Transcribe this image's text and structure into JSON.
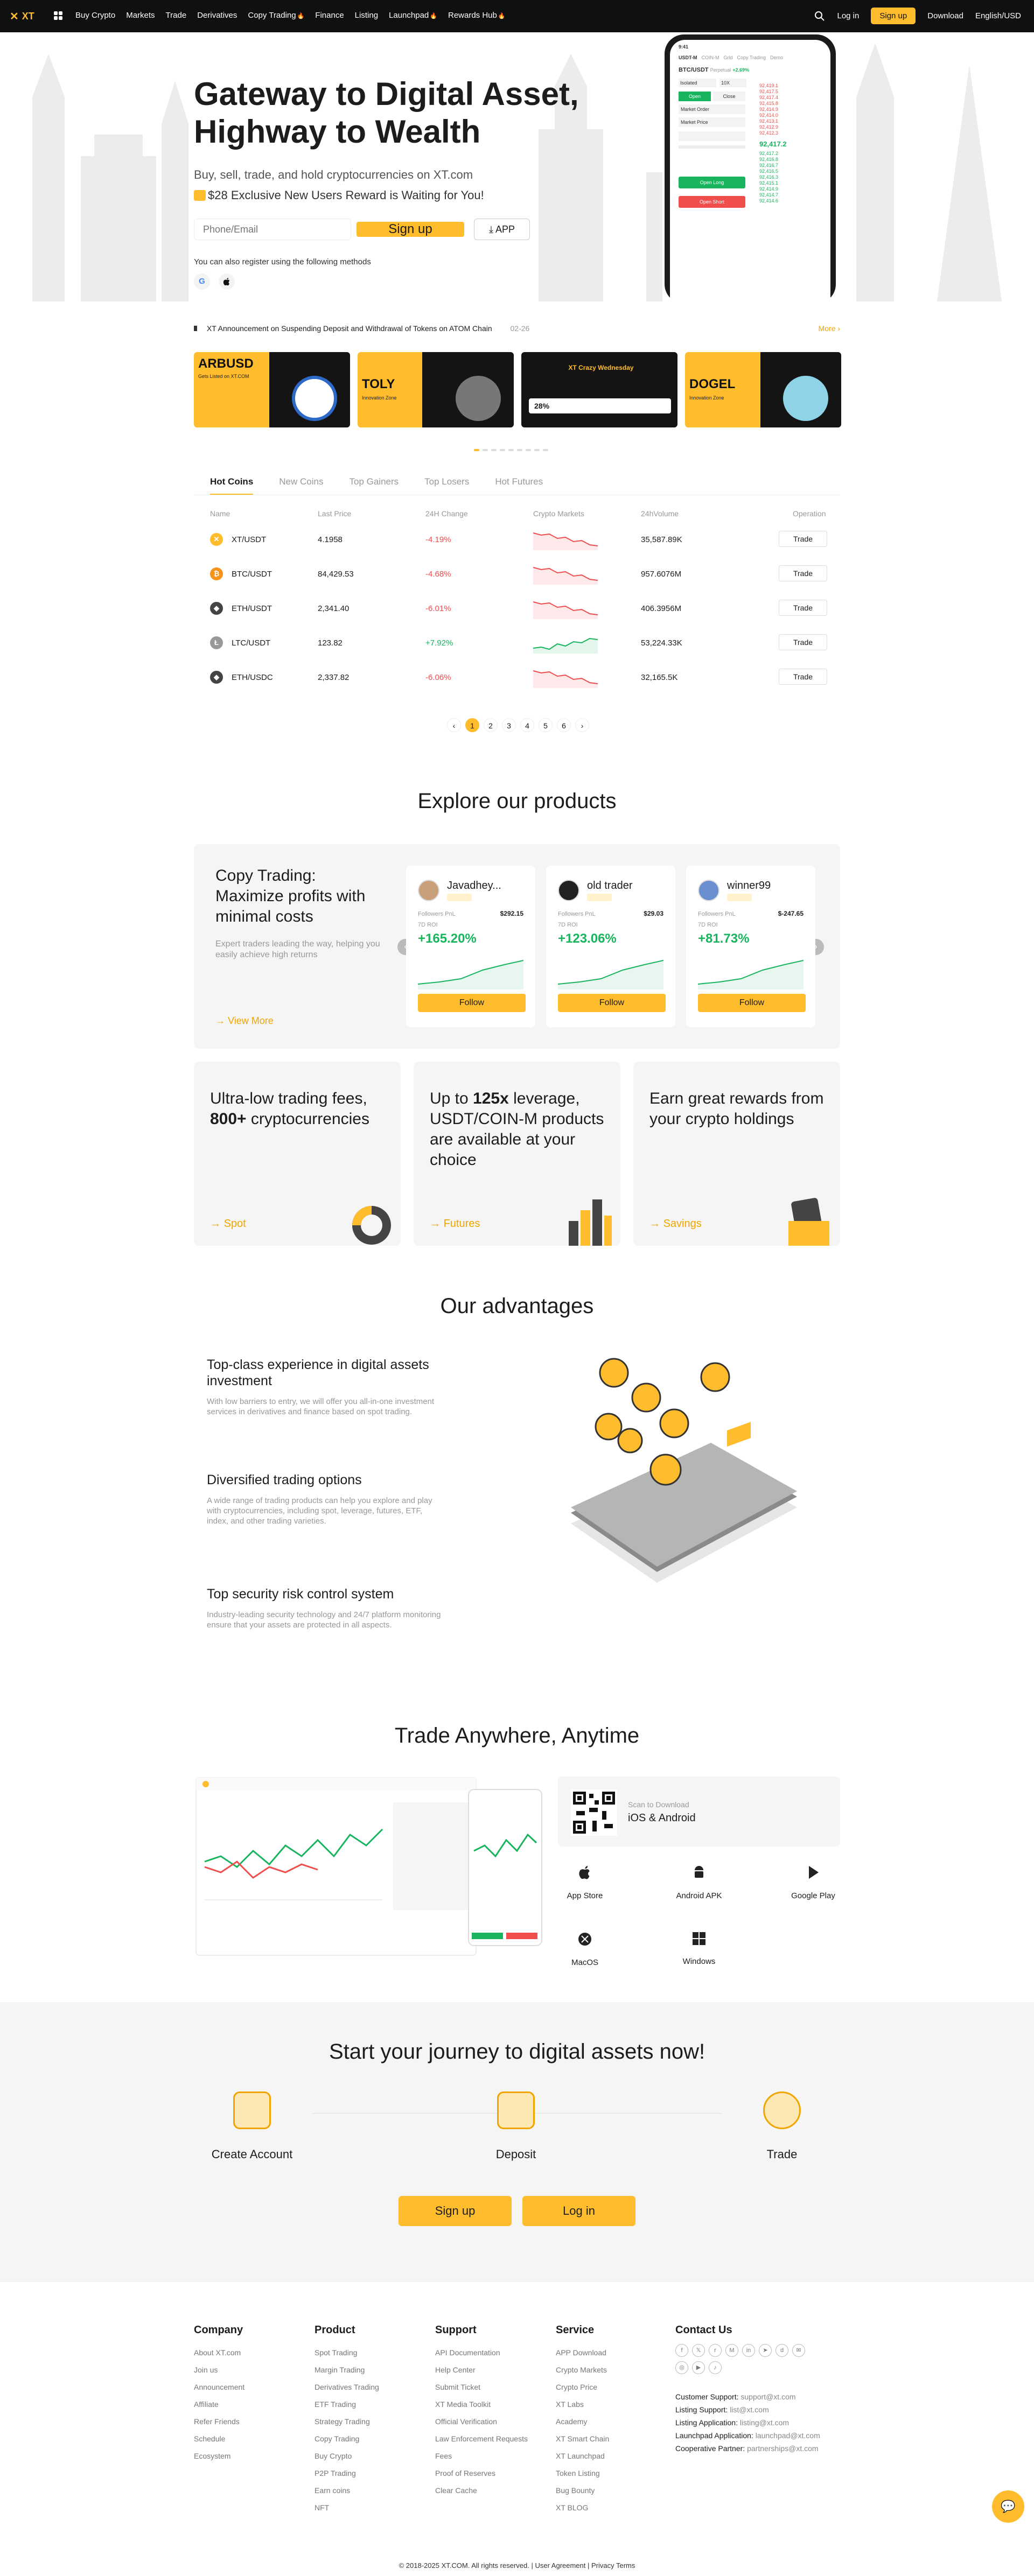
{
  "colors": {
    "accent": "#ffbd2e",
    "up": "#18b45e",
    "down": "#f04d4d",
    "dark": "#101010"
  },
  "nav": {
    "logo": "XT",
    "items": [
      "Buy Crypto",
      "Markets",
      "Trade",
      "Derivatives",
      "Copy Trading",
      "Finance",
      "Listing",
      "Launchpad",
      "Rewards Hub"
    ],
    "login": "Log in",
    "signup": "Sign up",
    "download": "Download",
    "lang": "English/USD"
  },
  "hero": {
    "title_line1": "Gateway to Digital Asset,",
    "title_line2": "Highway to Wealth",
    "subtitle": "Buy, sell, trade, and hold cryptocurrencies on XT.com",
    "promo": "$28 Exclusive New Users Reward is Waiting for You!",
    "input_placeholder": "Phone/Email",
    "signup_btn": "Sign up",
    "app_btn": "APP",
    "alt_register": "You can also register using the following methods",
    "social": [
      "G",
      ""
    ],
    "phone": {
      "time": "9:41",
      "tabs": [
        "USDT-M",
        "COIN-M",
        "Grid",
        "Copy Trading",
        "Demo"
      ],
      "pair": "BTC/USDT",
      "perp": "Perpetual",
      "change": "+2.69%",
      "mode": "Isolated",
      "lev": "10X",
      "open": "Open",
      "close": "Close",
      "order_type": "Market Order",
      "market_price": "Market Price",
      "price": "92,417.2",
      "open_long": "Open Long",
      "open_short": "Open Short",
      "asks": [
        "92,419.1",
        "92,417.5",
        "92,417.4",
        "92,415.8",
        "92,414.9",
        "92,414.0",
        "92,413.1",
        "92,412.9",
        "92,412.3"
      ],
      "bids": [
        "92,417.2",
        "92,416.8",
        "92,416.7",
        "92,416.5",
        "92,416.3",
        "92,415.1",
        "92,414.9",
        "92,414.7",
        "92,414.6"
      ]
    }
  },
  "announcement": {
    "icon": "megaphone-icon",
    "text": "XT Announcement on Suspending Deposit and Withdrawal of Tokens on ATOM Chain",
    "date": "02-26",
    "more": "More"
  },
  "banners": [
    {
      "title": "ARBUSD",
      "sub": "Gets Listed on XT.COM"
    },
    {
      "title": "TOLY",
      "sub": "Innovation Zone"
    },
    {
      "title": "XT Crazy Wednesday",
      "sub": "28%"
    },
    {
      "title": "DOGEL",
      "sub": "Innovation Zone"
    }
  ],
  "market": {
    "tabs": [
      "Hot Coins",
      "New Coins",
      "Top Gainers",
      "Top Losers",
      "Hot Futures"
    ],
    "headers": [
      "Name",
      "Last Price",
      "24H Change",
      "Crypto Markets",
      "24hVolume",
      "Operation"
    ],
    "rows": [
      {
        "pair": "XT/USDT",
        "price": "4.1958",
        "change": "-4.19%",
        "vol": "35,587.89K",
        "icon": "xt-icon",
        "color": "#ffbd2e",
        "glyph": "✕",
        "trend": "down"
      },
      {
        "pair": "BTC/USDT",
        "price": "84,429.53",
        "change": "-4.68%",
        "vol": "957.6076M",
        "icon": "btc-icon",
        "color": "#f7931a",
        "glyph": "₿",
        "trend": "down"
      },
      {
        "pair": "ETH/USDT",
        "price": "2,341.40",
        "change": "-6.01%",
        "vol": "406.3956M",
        "icon": "eth-icon",
        "color": "#444",
        "glyph": "◆",
        "trend": "down"
      },
      {
        "pair": "LTC/USDT",
        "price": "123.82",
        "change": "+7.92%",
        "vol": "53,224.33K",
        "icon": "ltc-icon",
        "color": "#999",
        "glyph": "Ł",
        "trend": "up"
      },
      {
        "pair": "ETH/USDC",
        "price": "2,337.82",
        "change": "-6.06%",
        "vol": "32,165.5K",
        "icon": "eth-icon",
        "color": "#444",
        "glyph": "◆",
        "trend": "down"
      }
    ],
    "trade_btn": "Trade",
    "pages": [
      "‹",
      "1",
      "2",
      "3",
      "4",
      "5",
      "6",
      "›"
    ]
  },
  "explore": {
    "title": "Explore our products",
    "copy": {
      "heading": "Copy Trading: Maximize profits with minimal costs",
      "desc": "Expert traders leading the way, helping you easily achieve high returns",
      "more": "View More"
    },
    "traders": [
      {
        "name": "Javadhey...",
        "pnl_label": "Followers PnL",
        "pnl": "$292.15",
        "roi_label": "7D ROI",
        "roi": "+165.20%",
        "follow": "Follow"
      },
      {
        "name": "old trader",
        "pnl_label": "Followers PnL",
        "pnl": "$29.03",
        "roi_label": "7D ROI",
        "roi": "+123.06%",
        "follow": "Follow"
      },
      {
        "name": "winner99",
        "pnl_label": "Followers PnL",
        "pnl": "$-247.65",
        "roi_label": "7D ROI",
        "roi": "+81.73%",
        "follow": "Follow"
      }
    ],
    "products": [
      {
        "pre": "Ultra-low trading fees, ",
        "strong": "800+",
        "post": " cryptocurrencies",
        "link": "Spot"
      },
      {
        "pre": "Up to ",
        "strong": "125x",
        "post": " leverage, USDT/COIN-M products are available at your choice",
        "link": "Futures"
      },
      {
        "pre": "Earn great rewards from your crypto holdings",
        "strong": "",
        "post": "",
        "link": "Savings"
      }
    ]
  },
  "advantages": {
    "title": "Our advantages",
    "items": [
      {
        "h": "Top-class experience in digital assets investment",
        "d": "With low barriers to entry, we will offer you all-in-one investment services in derivatives and finance based on spot trading."
      },
      {
        "h": "Diversified trading options",
        "d": "A wide range of trading products can help you explore and play with cryptocurrencies, including spot, leverage, futures, ETF, index, and other trading varieties."
      },
      {
        "h": "Top security risk control system",
        "d": "Industry-leading security technology and 24/7 platform monitoring ensure that your assets are protected in all aspects."
      }
    ]
  },
  "anywhere": {
    "title": "Trade Anywhere, Anytime",
    "scan": "Scan to Download",
    "os": "iOS & Android",
    "downloads": [
      {
        "label": "App Store",
        "icon": "apple-icon"
      },
      {
        "label": "Android APK",
        "icon": "android-icon"
      },
      {
        "label": "Google Play",
        "icon": "google-play-icon"
      },
      {
        "label": "MacOS",
        "icon": "macos-icon"
      },
      {
        "label": "Windows",
        "icon": "windows-icon"
      }
    ]
  },
  "journey": {
    "title": "Start your journey to digital assets now!",
    "steps": [
      "Create Account",
      "Deposit",
      "Trade"
    ],
    "signup": "Sign up",
    "login": "Log in"
  },
  "footer": {
    "company": {
      "title": "Company",
      "items": [
        "About XT.com",
        "Join us",
        "Announcement",
        "Affiliate",
        "Refer Friends",
        "Schedule",
        "Ecosystem"
      ]
    },
    "product": {
      "title": "Product",
      "items": [
        "Spot Trading",
        "Margin Trading",
        "Derivatives Trading",
        "ETF Trading",
        "Strategy Trading",
        "Copy Trading",
        "Buy Crypto",
        "P2P Trading",
        "Earn coins",
        "NFT"
      ]
    },
    "support": {
      "title": "Support",
      "items": [
        "API Documentation",
        "Help Center",
        "Submit Ticket",
        "XT Media Toolkit",
        "Official Verification",
        "Law Enforcement Requests",
        "Fees",
        "Proof of Reserves",
        "Clear Cache"
      ]
    },
    "service": {
      "title": "Service",
      "items": [
        "APP Download",
        "Crypto Markets",
        "Crypto Price",
        "XT Labs",
        "Academy",
        "XT Smart Chain",
        "XT Launchpad",
        "Token Listing",
        "Bug Bounty",
        "XT BLOG"
      ]
    },
    "contact": {
      "title": "Contact Us",
      "lines": [
        {
          "k": "Customer Support:",
          "v": "support@xt.com"
        },
        {
          "k": "Listing Support:",
          "v": "list@xt.com"
        },
        {
          "k": "Listing Application:",
          "v": "listing@xt.com"
        },
        {
          "k": "Launchpad Application:",
          "v": "launchpad@xt.com"
        },
        {
          "k": "Cooperative Partner:",
          "v": "partnerships@xt.com"
        }
      ]
    },
    "copyright": "© 2018-2025 XT.COM. All rights reserved. | User Agreement | Privacy Terms"
  }
}
